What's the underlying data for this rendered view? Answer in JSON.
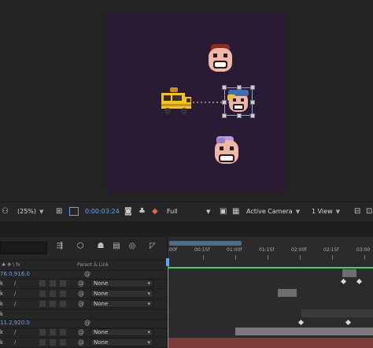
{
  "viewer": {
    "zoom": "(25%)",
    "timecode": "0:00:03:24",
    "resolution": "Full",
    "camera": "Active Camera",
    "view_layout": "1 View",
    "canvas_color": "#2a1b34"
  },
  "timeline": {
    "ruler_ticks": [
      ":00f",
      "00:15f",
      "01:00f",
      "01:15f",
      "02:00f",
      "02:15f",
      "03:00"
    ],
    "column_header": {
      "switch_icons": "♣ ✥ \\ fx",
      "parent_link": "Parent & Link"
    },
    "layers": [
      {
        "kind": "value",
        "value": "76.0,916.0"
      },
      {
        "kind": "layer",
        "letter": "k",
        "parent": "None"
      },
      {
        "kind": "layer",
        "letter": "k",
        "parent": "None"
      },
      {
        "kind": "layer",
        "letter": "k",
        "parent": "None"
      },
      {
        "kind": "value",
        "value": "11.2,920.0"
      },
      {
        "kind": "layer",
        "letter": "k",
        "parent": "None"
      },
      {
        "kind": "layer",
        "letter": "k",
        "parent": "None"
      }
    ],
    "accent_color": "#5aa6ff"
  }
}
